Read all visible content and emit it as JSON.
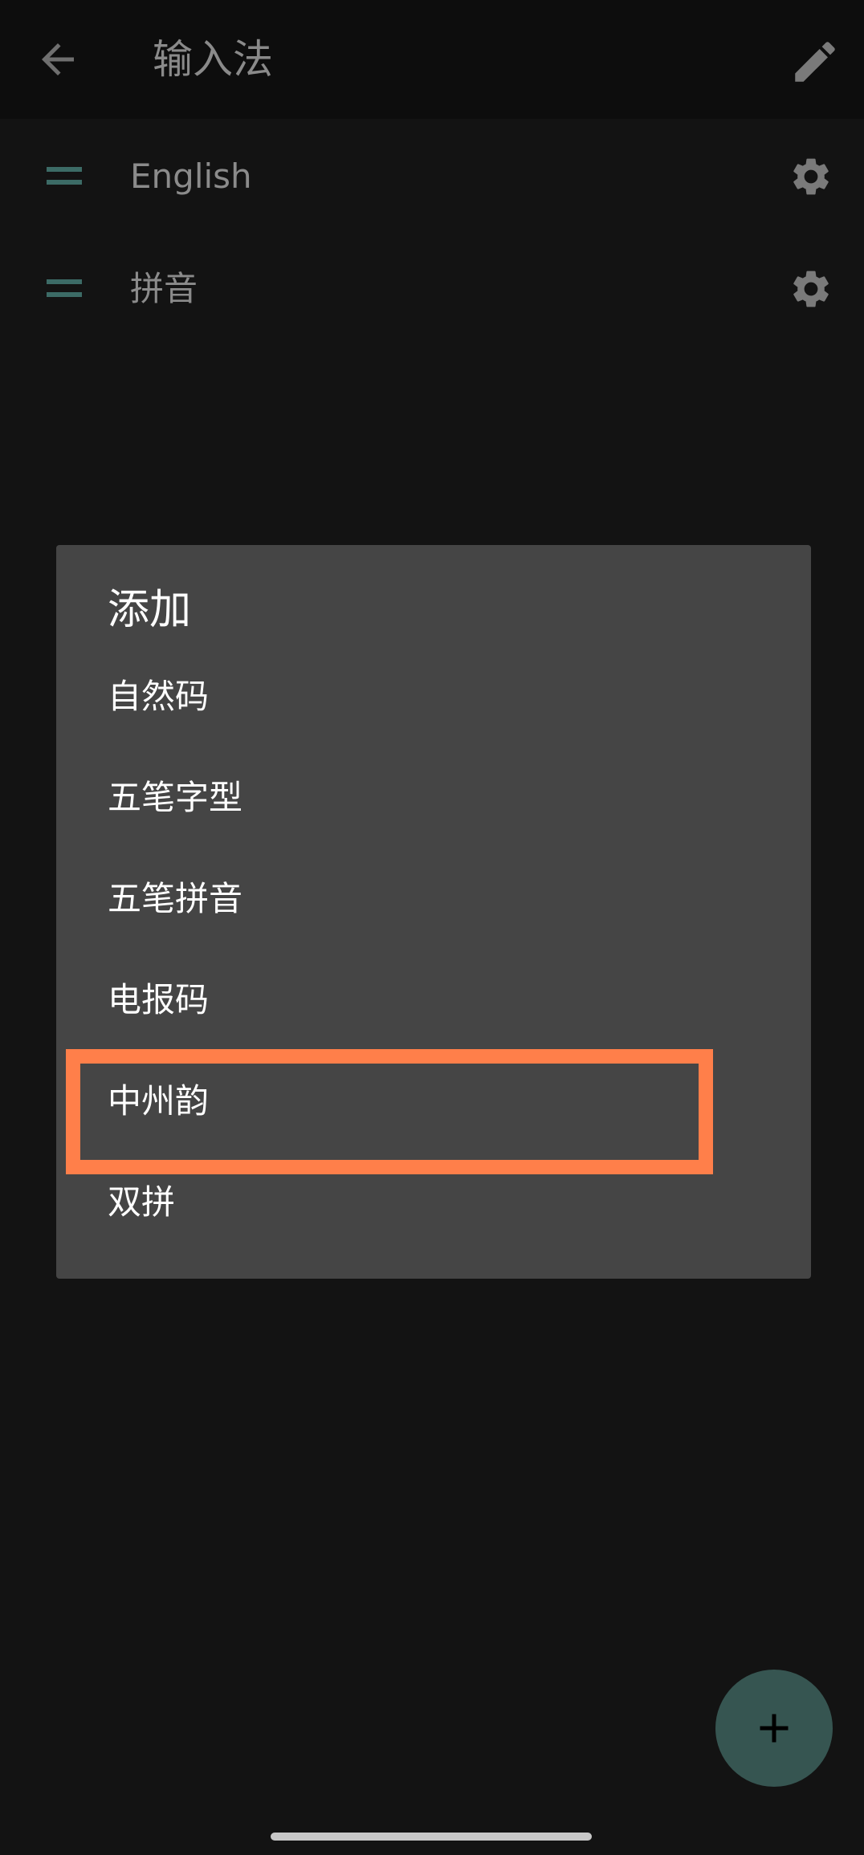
{
  "app_bar": {
    "title": "输入法",
    "back_icon": "arrow-back-icon",
    "edit_icon": "pencil-edit-icon"
  },
  "input_methods": [
    {
      "label": "English",
      "drag_icon": "drag-handle-icon",
      "settings_icon": "gear-icon"
    },
    {
      "label": "拼音",
      "drag_icon": "drag-handle-icon",
      "settings_icon": "gear-icon"
    }
  ],
  "add_dialog": {
    "title": "添加",
    "options": [
      {
        "label": "自然码"
      },
      {
        "label": "五笔字型"
      },
      {
        "label": "五笔拼音"
      },
      {
        "label": "电报码"
      },
      {
        "label": "中州韵",
        "highlighted": true
      },
      {
        "label": "双拼"
      }
    ]
  },
  "fab": {
    "icon": "plus-icon"
  },
  "colors": {
    "background": "#131313",
    "app_bar": "#0d0d0d",
    "dialog": "#454545",
    "accent": "#3c6b66",
    "fab": "#365551",
    "highlight": "#ff7f4a"
  }
}
